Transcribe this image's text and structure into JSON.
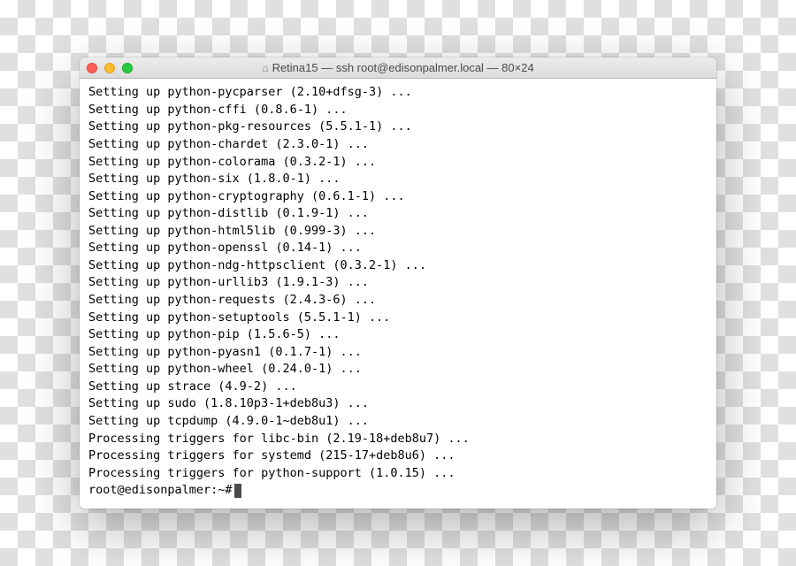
{
  "window": {
    "title": "Retina15 — ssh root@edisonpalmer.local — 80×24",
    "home_icon": "⌂"
  },
  "terminal": {
    "lines": [
      "Setting up python-pycparser (2.10+dfsg-3) ...",
      "Setting up python-cffi (0.8.6-1) ...",
      "Setting up python-pkg-resources (5.5.1-1) ...",
      "Setting up python-chardet (2.3.0-1) ...",
      "Setting up python-colorama (0.3.2-1) ...",
      "Setting up python-six (1.8.0-1) ...",
      "Setting up python-cryptography (0.6.1-1) ...",
      "Setting up python-distlib (0.1.9-1) ...",
      "Setting up python-html5lib (0.999-3) ...",
      "Setting up python-openssl (0.14-1) ...",
      "Setting up python-ndg-httpsclient (0.3.2-1) ...",
      "Setting up python-urllib3 (1.9.1-3) ...",
      "Setting up python-requests (2.4.3-6) ...",
      "Setting up python-setuptools (5.5.1-1) ...",
      "Setting up python-pip (1.5.6-5) ...",
      "Setting up python-pyasn1 (0.1.7-1) ...",
      "Setting up python-wheel (0.24.0-1) ...",
      "Setting up strace (4.9-2) ...",
      "Setting up sudo (1.8.10p3-1+deb8u3) ...",
      "Setting up tcpdump (4.9.0-1~deb8u1) ...",
      "Processing triggers for libc-bin (2.19-18+deb8u7) ...",
      "Processing triggers for systemd (215-17+deb8u6) ...",
      "Processing triggers for python-support (1.0.15) ..."
    ],
    "prompt": "root@edisonpalmer:~# "
  }
}
